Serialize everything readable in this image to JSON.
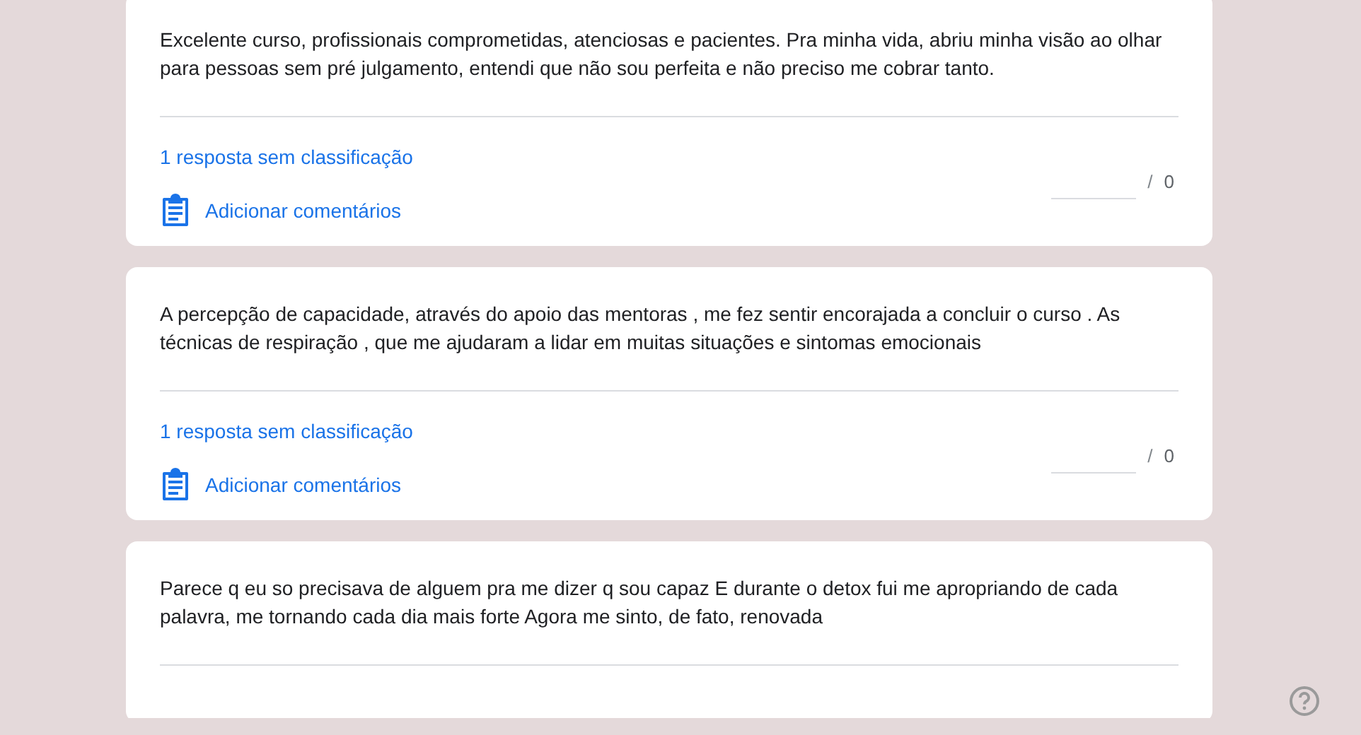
{
  "responses": [
    {
      "text": "Excelente curso, profissionais comprometidas, atenciosas e pacientes. Pra minha vida, abriu minha visão ao olhar para pessoas sem pré julgamento, entendi que não sou perfeita e não preciso me cobrar tanto.",
      "ungraded": "1 resposta sem classificação",
      "add_comment": "Adicionar comentários",
      "score_separator": "/",
      "score_max": "0"
    },
    {
      "text": "A percepção de capacidade, através do apoio das mentoras , me fez sentir encorajada a concluir o curso . As técnicas de respiração , que me ajudaram a lidar em muitas situações e sintomas emocionais",
      "ungraded": "1 resposta sem classificação",
      "add_comment": "Adicionar comentários",
      "score_separator": "/",
      "score_max": "0"
    },
    {
      "text": "Parece q eu so precisava de alguem pra me dizer q sou capaz E durante o detox fui me apropriando de cada palavra, me tornando cada dia mais forte Agora me sinto, de fato, renovada"
    }
  ]
}
